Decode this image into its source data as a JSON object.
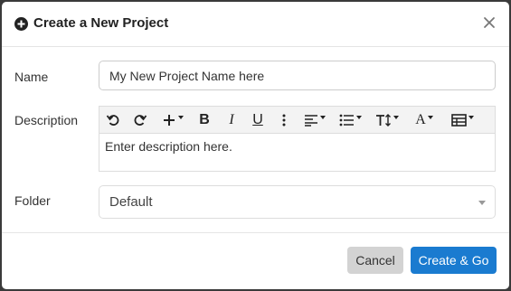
{
  "dialog": {
    "title": "Create a New Project",
    "title_icon": "plus-circle-icon",
    "close_icon": "close-icon"
  },
  "form": {
    "name_label": "Name",
    "name_value": "My New Project Name here",
    "description_label": "Description",
    "description_placeholder": "Enter description here.",
    "folder_label": "Folder",
    "folder_value": "Default"
  },
  "toolbar": {
    "buttons": [
      {
        "icon": "undo-icon"
      },
      {
        "icon": "redo-icon"
      },
      {
        "icon": "insert-plus-icon",
        "dropdown": true
      },
      {
        "icon": "bold-icon",
        "text": "B"
      },
      {
        "icon": "italic-icon",
        "text": "I"
      },
      {
        "icon": "underline-icon",
        "text": "U"
      },
      {
        "icon": "more-vertical-icon"
      },
      {
        "icon": "align-icon",
        "dropdown": true
      },
      {
        "icon": "list-icon",
        "dropdown": true
      },
      {
        "icon": "text-size-icon",
        "dropdown": true
      },
      {
        "icon": "font-color-icon",
        "text": "A",
        "dropdown": true
      },
      {
        "icon": "table-icon",
        "dropdown": true
      }
    ]
  },
  "footer": {
    "cancel_label": "Cancel",
    "submit_label": "Create & Go"
  },
  "colors": {
    "primary": "#1a7bd0",
    "cancel": "#d3d3d3",
    "backdrop": "#3a3a3a"
  }
}
